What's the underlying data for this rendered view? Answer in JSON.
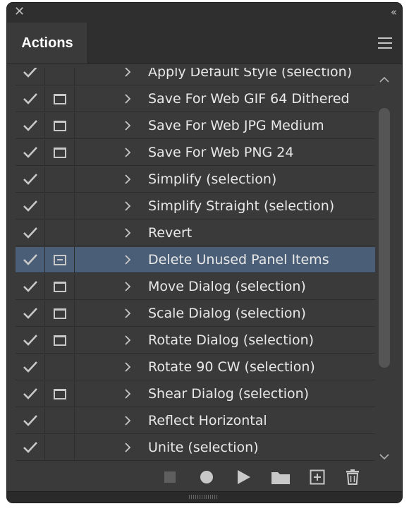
{
  "window": {
    "close_icon": "close-icon",
    "collapse_icon": "double-chevron-left-icon",
    "close_glyph": "✕",
    "collapse_glyph": "‹‹"
  },
  "panel": {
    "tab_title": "Actions",
    "menu_icon": "hamburger-menu-icon"
  },
  "colors": {
    "panel_bg": "#3a3a3a",
    "selected_row": "#4a5f77",
    "text": "#e8e8e8",
    "icon": "#c8c8c8"
  },
  "actions": [
    {
      "label": "Apply Default Style (selection)",
      "checked": true,
      "dialog": false,
      "selected": false
    },
    {
      "label": "Save For Web GIF 64 Dithered",
      "checked": true,
      "dialog": true,
      "selected": false
    },
    {
      "label": "Save For Web JPG Medium",
      "checked": true,
      "dialog": true,
      "selected": false
    },
    {
      "label": "Save For Web PNG 24",
      "checked": true,
      "dialog": true,
      "selected": false
    },
    {
      "label": "Simplify (selection)",
      "checked": true,
      "dialog": false,
      "selected": false
    },
    {
      "label": "Simplify Straight (selection)",
      "checked": true,
      "dialog": false,
      "selected": false
    },
    {
      "label": "Revert",
      "checked": true,
      "dialog": false,
      "selected": false
    },
    {
      "label": "Delete Unused Panel Items",
      "checked": true,
      "dialog": true,
      "selected": true
    },
    {
      "label": "Move Dialog (selection)",
      "checked": true,
      "dialog": true,
      "selected": false
    },
    {
      "label": "Scale Dialog (selection)",
      "checked": true,
      "dialog": true,
      "selected": false
    },
    {
      "label": "Rotate Dialog (selection)",
      "checked": true,
      "dialog": true,
      "selected": false
    },
    {
      "label": "Rotate 90 CW (selection)",
      "checked": true,
      "dialog": false,
      "selected": false
    },
    {
      "label": "Shear Dialog (selection)",
      "checked": true,
      "dialog": true,
      "selected": false
    },
    {
      "label": "Reflect Horizontal",
      "checked": true,
      "dialog": false,
      "selected": false
    },
    {
      "label": "Unite (selection)",
      "checked": true,
      "dialog": false,
      "selected": false
    }
  ],
  "scroll": {
    "position_fraction": 0.22,
    "visible_fraction": 0.7
  },
  "toolbar": [
    {
      "name": "stop-icon",
      "enabled": false
    },
    {
      "name": "record-icon",
      "enabled": true
    },
    {
      "name": "play-icon",
      "enabled": true
    },
    {
      "name": "new-set-folder-icon",
      "enabled": true
    },
    {
      "name": "new-action-icon",
      "enabled": true
    },
    {
      "name": "trash-icon",
      "enabled": true
    }
  ]
}
